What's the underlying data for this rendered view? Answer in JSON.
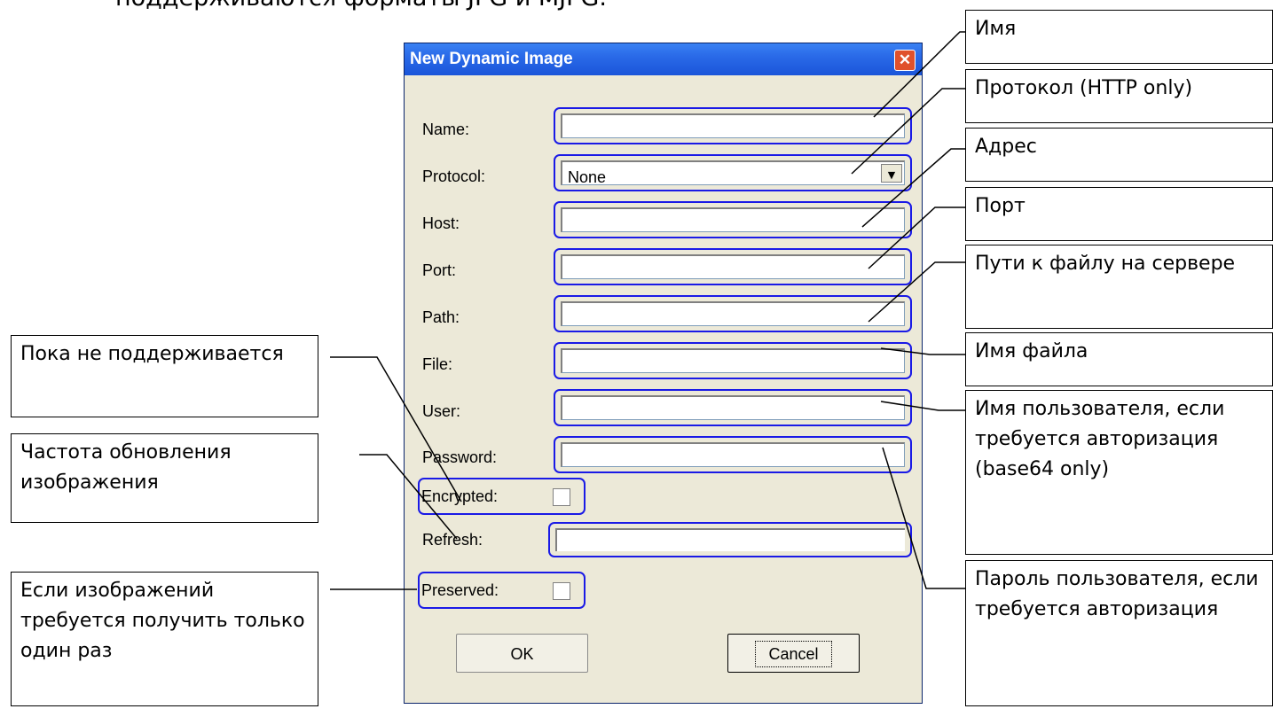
{
  "header_text": "поддерживаются форматы JPG и MJPG.",
  "dialog": {
    "title": "New Dynamic Image",
    "close_glyph": "✕",
    "fields": {
      "name": "Name:",
      "protocol": "Protocol:",
      "protocol_value": "None",
      "host": "Host:",
      "port": "Port:",
      "path": "Path:",
      "file": "File:",
      "user": "User:",
      "password": "Password:",
      "encrypted": "Encrypted:",
      "refresh": "Refresh:",
      "preserved": "Preserved:"
    },
    "ok": "OK",
    "cancel": "Cancel"
  },
  "callouts": {
    "name": "Имя",
    "protocol": "Протокол (HTTP only)",
    "host": "Адрес",
    "port": "Порт",
    "path": "Пути к файлу на сервере",
    "file": "Имя файла",
    "user": "Имя пользователя, если требуется авторизация (base64 only)",
    "password": "Пароль пользователя, если требуется авторизация",
    "encrypted": "Пока не поддерживается",
    "refresh": "Частота обновления изображения",
    "preserved": "Если изображений требуется получить только один раз"
  },
  "colors": {
    "highlight": "#1a1ae6",
    "dialog_bg": "#ece9d8",
    "titlebar": "#2a6ae8"
  }
}
